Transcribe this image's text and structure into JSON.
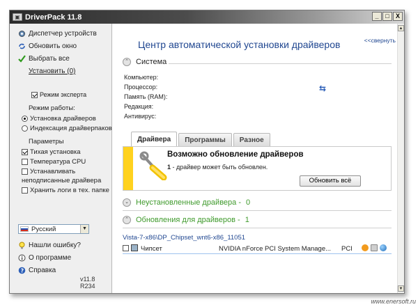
{
  "window": {
    "title": "DriverPack 11.8",
    "buttons": {
      "minimize": "_",
      "maximize": "□",
      "close": "X"
    }
  },
  "sidebar": {
    "links": [
      {
        "label": "Диспетчер устройств",
        "icon": "device-manager-icon"
      },
      {
        "label": "Обновить окно",
        "icon": "refresh-icon"
      },
      {
        "label": "Выбрать все",
        "icon": "checkmark-icon"
      },
      {
        "label": "Установить (0)"
      }
    ],
    "expert_mode": {
      "label": "Режим эксперта",
      "checked": true
    },
    "mode_label": "Режим работы:",
    "modes": [
      {
        "label": "Установка драйверов",
        "selected": true
      },
      {
        "label": "Индексация драйверпаков",
        "selected": false
      }
    ],
    "params_label": "Параметры",
    "params": [
      {
        "label": "Тихая установка",
        "checked": true
      },
      {
        "label": "Температура CPU",
        "checked": false
      },
      {
        "label": "Устанавливать",
        "label2": "неподписанные драйвера",
        "checked": false
      },
      {
        "label": "Хранить логи в тех. папке",
        "checked": false
      }
    ],
    "language": {
      "value": "Русский"
    },
    "bottom_links": [
      {
        "label": "Нашли ошибку?",
        "icon": "lightbulb-icon"
      },
      {
        "label": "О программе",
        "icon": "info-icon"
      },
      {
        "label": "Справка",
        "icon": "help-icon"
      }
    ],
    "version": "v11.8 R234"
  },
  "main": {
    "title": "Центр автоматической установки драйверов",
    "collapse_link": "<<свернуть",
    "system_section": {
      "title": "Система",
      "fields": [
        "Компьютер:",
        "Процессор:",
        "Память (RAM):",
        "Редакция:",
        "Антивирус:"
      ]
    },
    "tabs": [
      "Драйвера",
      "Программы",
      "Разное"
    ],
    "update_box": {
      "title": "Возможно обновление драйверов",
      "count": "1",
      "subtitle": " - драйвер может быть обновлен.",
      "button": "Обновить всё"
    },
    "uninstalled_section": {
      "title": "Неустановленные драйвера -",
      "count": "0"
    },
    "updates_section": {
      "title": "Обновления для драйверов -",
      "count": "1"
    },
    "driver_path": "Vista-7-x86\\DP_Chipset_wnt6-x86_11051",
    "driver_row": {
      "category": "Чипсет",
      "name": "NVIDIA nForce PCI System Manage...",
      "bus": "PCI"
    }
  },
  "watermark": "www.enersoft.ru",
  "colors": {
    "accent_blue": "#1f4690",
    "green": "#3f9a2c",
    "yellow_stripe": "#ffd21f"
  }
}
